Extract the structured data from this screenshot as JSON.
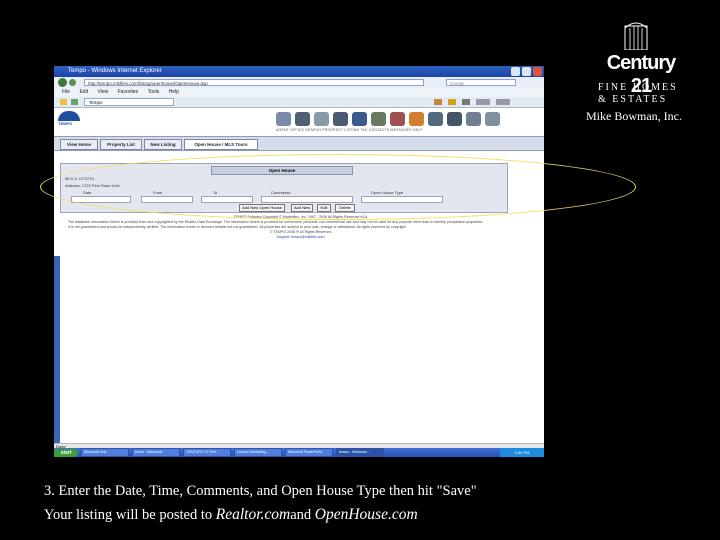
{
  "browser": {
    "title": "Tempo - Windows Internet Explorer",
    "address": "http://tempo.mlsfiles.com/listing/openhouse/OpenHouse.asp",
    "search_placeholder": "Google",
    "menu": [
      "File",
      "Edit",
      "View",
      "Favorites",
      "Tools",
      "Help"
    ],
    "tab_title": "Tempo"
  },
  "app": {
    "logo_text": "TEMPO",
    "nav_labels": "AGENT    OFFICE    SEARCH    PROSPECT    LISTING    TAX    CONTACTS    MESSAGES    HELP",
    "tabs": [
      "View Home",
      "Property List",
      "New Listing",
      "Open House / MLS Tours"
    ],
    "panel": {
      "title": "Open House",
      "mls": "MLS #: 1272701",
      "address": "Address: 1722 Pine Road   Unit:",
      "col_date": "Date",
      "col_from": "From",
      "col_to": "To",
      "col_comments": "Comments",
      "col_type": "Open House Type",
      "buttons": [
        "Add New Open House",
        "Add New",
        "Edit",
        "Delete"
      ]
    },
    "footer": {
      "copyright1": "TEMPO Software Copyright © Marketlinx, Inc. 1997 - 2006 All Rights Reserved v5.6",
      "line1": "The database information herein is provided from and copyrighted by the Realtor Data Exchange. The information herein is provided for consumers' personal, non-commercial use and may not be used for any purpose other than to identify prospective properties.",
      "line2": "It is not guaranteed and should be independently verified. The information herein is deemed reliable but not guaranteed. All properties are subject to prior sale, change or withdrawal. All rights reserved by copyright.",
      "copyright2": "© TEMPO 2006 ® All Rights Reserved",
      "support": "Support: tempo@mlsfiles.com"
    },
    "status": "Done"
  },
  "taskbar": {
    "start": "start",
    "items": [
      "Microsoft Outl...",
      "Inbox - Microsoft...",
      "CENTURY 21 Fine...",
      "Lenovo Marketing...",
      "Microsoft PowerPoint",
      "tempo - Windows..."
    ],
    "tray": "3:53 PM"
  },
  "branding": {
    "century21": "Century 21",
    "fine_homes": "FINE HOMES",
    "estates": "& ESTATES",
    "office": "Mike Bowman, Inc."
  },
  "caption": {
    "line1": "3. Enter the Date, Time, Comments, and Open House Type then hit \"Save\"",
    "line2_prefix": "Your listing will be posted to ",
    "realtor": "Realtor.com",
    "and": "and ",
    "openhouse": "OpenHouse.com"
  },
  "colors": {
    "background": "#000000",
    "highlight_ellipse": "#f0e060",
    "titlebar": "#1b45a8",
    "tabs": "#d6dcea"
  }
}
